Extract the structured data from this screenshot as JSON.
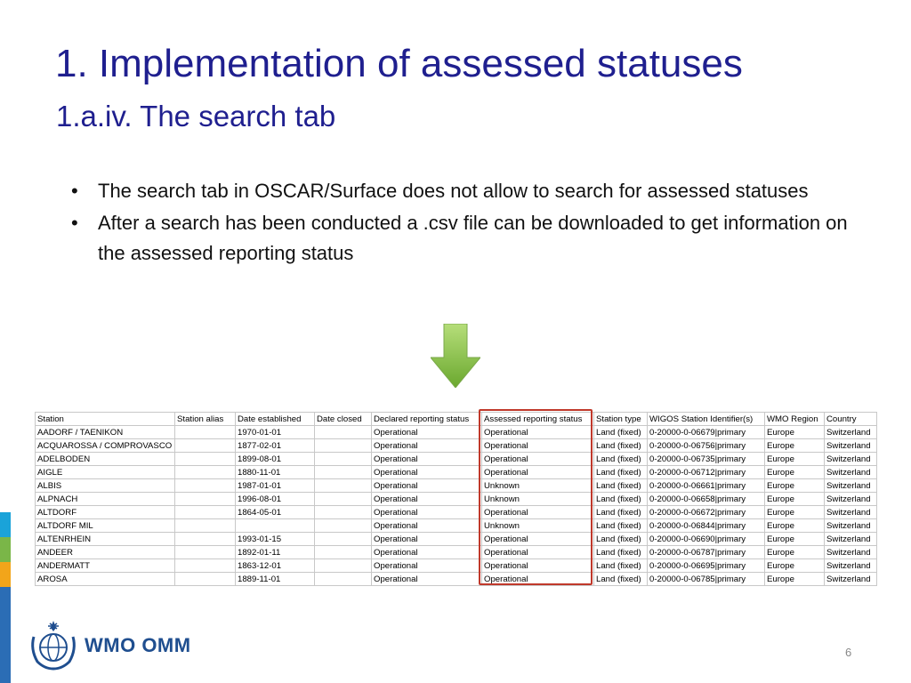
{
  "slide": {
    "title": "1. Implementation of assessed statuses",
    "subtitle": "1.a.iv. The search tab",
    "bullets": [
      "The search tab in OSCAR/Surface does not allow to search for assessed statuses",
      "After a search has been conducted a .csv file can be downloaded to get information on the assessed reporting status"
    ],
    "logo_text": "WMO OMM",
    "page_number": "6"
  },
  "table": {
    "columns": [
      "Station",
      "Station alias",
      "Date established",
      "Date closed",
      "Declared reporting status",
      "Assessed reporting status",
      "Station type",
      "WIGOS Station Identifier(s)",
      "WMO Region",
      "Country"
    ],
    "rows": [
      [
        "AADORF / TAENIKON",
        "",
        "1970-01-01",
        "",
        "Operational",
        "Operational",
        "Land (fixed)",
        "0-20000-0-06679|primary",
        "Europe",
        "Switzerland"
      ],
      [
        "ACQUAROSSA / COMPROVASCO",
        "",
        "1877-02-01",
        "",
        "Operational",
        "Operational",
        "Land (fixed)",
        "0-20000-0-06756|primary",
        "Europe",
        "Switzerland"
      ],
      [
        "ADELBODEN",
        "",
        "1899-08-01",
        "",
        "Operational",
        "Operational",
        "Land (fixed)",
        "0-20000-0-06735|primary",
        "Europe",
        "Switzerland"
      ],
      [
        "AIGLE",
        "",
        "1880-11-01",
        "",
        "Operational",
        "Operational",
        "Land (fixed)",
        "0-20000-0-06712|primary",
        "Europe",
        "Switzerland"
      ],
      [
        "ALBIS",
        "",
        "1987-01-01",
        "",
        "Operational",
        "Unknown",
        "Land (fixed)",
        "0-20000-0-06661|primary",
        "Europe",
        "Switzerland"
      ],
      [
        "ALPNACH",
        "",
        "1996-08-01",
        "",
        "Operational",
        "Unknown",
        "Land (fixed)",
        "0-20000-0-06658|primary",
        "Europe",
        "Switzerland"
      ],
      [
        "ALTDORF",
        "",
        "1864-05-01",
        "",
        "Operational",
        "Operational",
        "Land (fixed)",
        "0-20000-0-06672|primary",
        "Europe",
        "Switzerland"
      ],
      [
        "ALTDORF MIL",
        "",
        "",
        "",
        "Operational",
        "Unknown",
        "Land (fixed)",
        "0-20000-0-06844|primary",
        "Europe",
        "Switzerland"
      ],
      [
        "ALTENRHEIN",
        "",
        "1993-01-15",
        "",
        "Operational",
        "Operational",
        "Land (fixed)",
        "0-20000-0-06690|primary",
        "Europe",
        "Switzerland"
      ],
      [
        "ANDEER",
        "",
        "1892-01-11",
        "",
        "Operational",
        "Operational",
        "Land (fixed)",
        "0-20000-0-06787|primary",
        "Europe",
        "Switzerland"
      ],
      [
        "ANDERMATT",
        "",
        "1863-12-01",
        "",
        "Operational",
        "Operational",
        "Land (fixed)",
        "0-20000-0-06695|primary",
        "Europe",
        "Switzerland"
      ],
      [
        "AROSA",
        "",
        "1889-11-01",
        "",
        "Operational",
        "Operational",
        "Land (fixed)",
        "0-20000-0-06785|primary",
        "Europe",
        "Switzerland"
      ]
    ]
  },
  "colors": {
    "title": "#1f1f8f",
    "highlight_border": "#c0392b",
    "arrow": "#8cc63f",
    "stripes": [
      "#1aa3d9",
      "#7ab648",
      "#f2a51a",
      "#2b6db5"
    ]
  }
}
